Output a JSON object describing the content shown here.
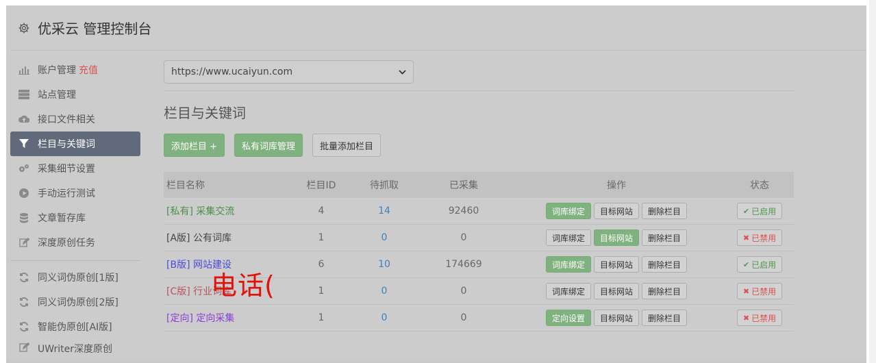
{
  "header": {
    "title": "优采云 管理控制台",
    "icon": "gear-icon"
  },
  "sidebar": {
    "items": [
      {
        "label": "账户管理",
        "extra": "充值",
        "icon": "bar-chart-icon"
      },
      {
        "label": "站点管理",
        "icon": "server-icon"
      },
      {
        "label": "接口文件相关",
        "icon": "cloud-upload-icon"
      },
      {
        "label": "栏目与关键词",
        "icon": "filter-icon",
        "active": true
      },
      {
        "label": "采集细节设置",
        "icon": "gears-icon"
      },
      {
        "label": "手动运行测试",
        "icon": "play-circle-icon"
      },
      {
        "label": "文章暂存库",
        "icon": "database-icon"
      },
      {
        "label": "深度原创任务",
        "icon": "edit-icon"
      }
    ],
    "items2": [
      {
        "label": "同义词伪原创[1版]",
        "icon": "refresh-icon"
      },
      {
        "label": "同义词伪原创[2版]",
        "icon": "refresh-icon"
      },
      {
        "label": "智能伪原创[AI版]",
        "icon": "refresh-icon"
      },
      {
        "label": "UWriter深度原创",
        "icon": "edit-icon"
      }
    ]
  },
  "main": {
    "site_select": {
      "value": "https://www.ucaiyun.com"
    },
    "section_title": "栏目与关键词",
    "buttons": {
      "add_column": "添加栏目 +",
      "private_lib": "私有词库管理",
      "batch_add": "批量添加栏目"
    },
    "table": {
      "headers": {
        "name": "栏目名称",
        "id": "栏目ID",
        "wait": "待抓取",
        "done": "已采集",
        "ops": "操作",
        "status": "状态"
      },
      "rows": [
        {
          "tag": "[私有]",
          "name": "采集交流",
          "id": "4",
          "wait": "14",
          "done": "92460",
          "op1": "词库绑定",
          "op2": "目标网站",
          "op3": "删除栏目",
          "status": "已启用"
        },
        {
          "tag": "[A版]",
          "name": "公有词库",
          "id": "1",
          "wait": "0",
          "done": "0",
          "op1": "词库绑定",
          "op2": "目标网站",
          "op3": "删除栏目",
          "status": "已禁用"
        },
        {
          "tag": "[B版]",
          "name": "网站建设",
          "id": "6",
          "wait": "10",
          "done": "174669",
          "op1": "词库绑定",
          "op2": "目标网站",
          "op3": "删除栏目",
          "status": "已启用"
        },
        {
          "tag": "[C版]",
          "name": "行业词库",
          "id": "1",
          "wait": "0",
          "done": "0",
          "op1": "词库绑定",
          "op2": "目标网站",
          "op3": "删除栏目",
          "status": "已禁用"
        },
        {
          "tag": "[定向]",
          "name": "定向采集",
          "id": "1",
          "wait": "0",
          "done": "0",
          "op1": "定向设置",
          "op2": "目标网站",
          "op3": "删除栏目",
          "status": "已禁用"
        }
      ]
    }
  },
  "watermark": "电话(",
  "colors": {
    "active_nav": "#616a7b",
    "green": "#7fb27f",
    "red": "#d9534f",
    "blue_link": "#3f7fb8"
  }
}
